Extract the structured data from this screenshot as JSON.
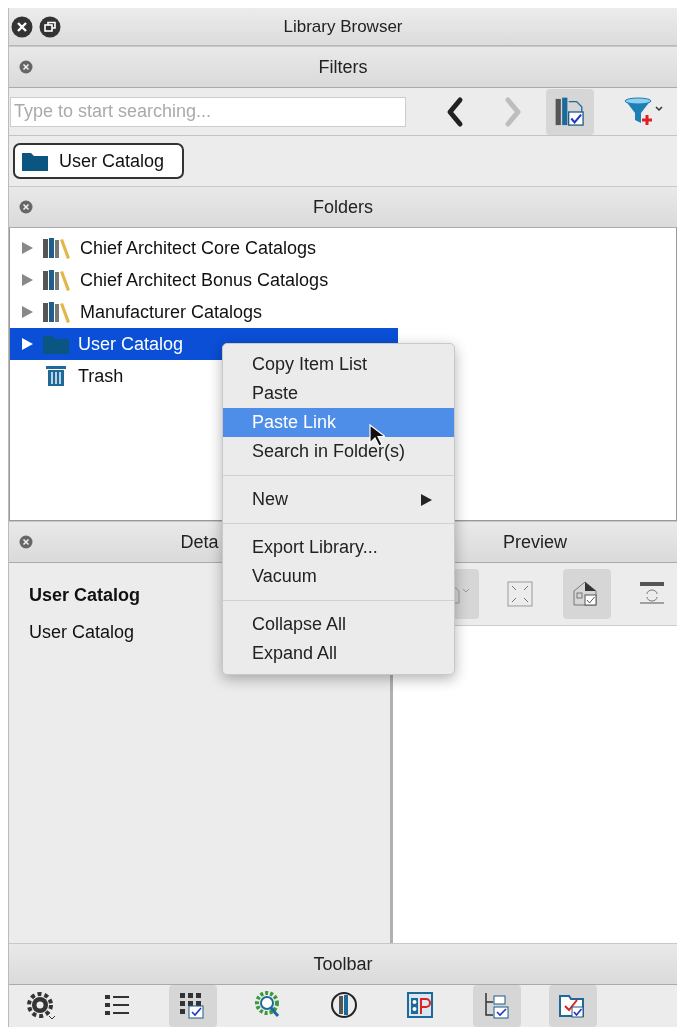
{
  "window": {
    "title": "Library Browser"
  },
  "filters": {
    "title": "Filters",
    "search": {
      "placeholder": "Type to start searching..."
    },
    "buttons": [
      {
        "disabled": false
      },
      {
        "disabled": true
      },
      {
        "selected": true
      }
    ],
    "chip": "User Catalog"
  },
  "folders": {
    "title": "Folders",
    "items": [
      {
        "label": "Chief Architect Core Catalogs",
        "kind": "books",
        "expandable": true,
        "selected": false
      },
      {
        "label": "Chief Architect Bonus Catalogs",
        "kind": "books",
        "expandable": true,
        "selected": false
      },
      {
        "label": "Manufacturer Catalogs",
        "kind": "books",
        "expandable": true,
        "selected": false
      },
      {
        "label": "User Catalog",
        "kind": "folder",
        "expandable": true,
        "selected": true
      },
      {
        "label": "Trash",
        "kind": "trash",
        "expandable": false,
        "selected": false
      }
    ]
  },
  "details": {
    "title": "Deta",
    "name": "User Catalog",
    "description": "User Catalog"
  },
  "preview": {
    "title": "Preview",
    "buttons": [
      {
        "selected": true
      },
      {
        "selected": false
      },
      {
        "selected": true
      },
      {
        "selected": false
      }
    ]
  },
  "context_menu": {
    "items": [
      {
        "kind": "item",
        "label": "Copy Item List",
        "selected": false
      },
      {
        "kind": "item",
        "label": "Paste",
        "selected": false
      },
      {
        "kind": "item",
        "label": "Paste Link",
        "selected": true
      },
      {
        "kind": "item",
        "label": "Search in Folder(s)",
        "selected": false
      },
      {
        "kind": "separator"
      },
      {
        "kind": "submenu",
        "label": "New",
        "selected": false
      },
      {
        "kind": "separator"
      },
      {
        "kind": "item",
        "label": "Export Library...",
        "selected": false
      },
      {
        "kind": "item",
        "label": "Vacuum",
        "selected": false
      },
      {
        "kind": "separator"
      },
      {
        "kind": "item",
        "label": "Collapse All",
        "selected": false
      },
      {
        "kind": "item",
        "label": "Expand All",
        "selected": false
      }
    ]
  },
  "toolbar": {
    "title": "Toolbar",
    "buttons": [
      {
        "selected": false
      },
      {
        "selected": false
      },
      {
        "selected": true
      },
      {
        "selected": false
      },
      {
        "selected": false
      },
      {
        "selected": false
      },
      {
        "selected": true
      },
      {
        "selected": true
      }
    ]
  }
}
